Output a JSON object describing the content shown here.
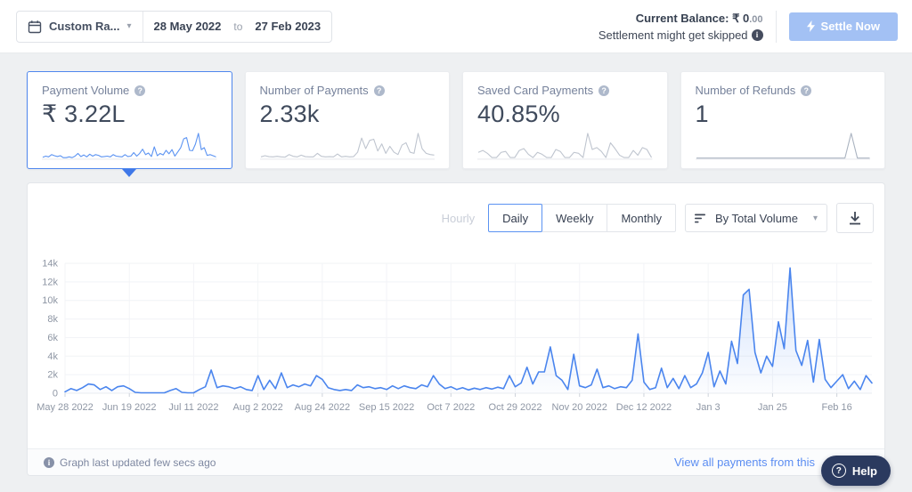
{
  "topbar": {
    "range_label": "Custom Ra...",
    "date_from": "28 May 2022",
    "to": "to",
    "date_to": "27 Feb 2023",
    "balance_label": "Current Balance:",
    "balance_currency": "₹",
    "balance_whole": "0",
    "balance_decimals": ".00",
    "settlement_note": "Settlement might get skipped",
    "settle_label": "Settle Now"
  },
  "cards": [
    {
      "label": "Payment Volume",
      "value": "₹ 3.22L",
      "selected": true
    },
    {
      "label": "Number of Payments",
      "value": "2.33k",
      "selected": false
    },
    {
      "label": "Saved Card Payments",
      "value": "40.85%",
      "selected": false
    },
    {
      "label": "Number of Refunds",
      "value": "1",
      "selected": false
    }
  ],
  "controls": {
    "tabs": [
      {
        "label": "Hourly",
        "state": "disabled"
      },
      {
        "label": "Daily",
        "state": "selected"
      },
      {
        "label": "Weekly",
        "state": "normal"
      },
      {
        "label": "Monthly",
        "state": "normal"
      }
    ],
    "sort_label": "By Total Volume"
  },
  "footer": {
    "updated": "Graph last updated few secs ago",
    "link": "View all payments from this"
  },
  "help": {
    "label": "Help"
  },
  "colors": {
    "accent_blue": "#4a85ee",
    "selected_card_border": "#4f87ee",
    "settle_button_bg": "#a3c1f4",
    "help_button_bg": "#2b3a5f",
    "spark_gray": "#bfc5cf",
    "axis_text": "#8e96a4",
    "grid_line": "#f1f3f6",
    "link_blue": "#5b8df2"
  },
  "icons": {
    "calendar-icon": "date range picker",
    "chevron-down-icon": "▾",
    "info-icon": "i in filled circle",
    "bolt-icon": "lightning flash on settle button",
    "question-icon": "? in circle",
    "sort-icon": "three descending bars",
    "download-icon": "arrow down to bar"
  },
  "chart_data": [
    {
      "type": "area",
      "title": "Daily Payment Volume",
      "granularity": "Daily",
      "xlabel": "",
      "ylabel": "",
      "ylim": [
        0,
        14000
      ],
      "grid": true,
      "legend": "none",
      "y_tick_labels": [
        "0",
        "2k",
        "4k",
        "6k",
        "8k",
        "10k",
        "12k",
        "14k"
      ],
      "x_tick_labels": [
        "May 28 2022",
        "Jun 19 2022",
        "Jul 11 2022",
        "Aug 2 2022",
        "Aug 24 2022",
        "Sep 15 2022",
        "Oct 7 2022",
        "Oct 29 2022",
        "Nov 20 2022",
        "Dec 12 2022",
        "Jan 3",
        "Jan 25",
        "Feb 16"
      ],
      "x_tick_indices": [
        0,
        11,
        22,
        33,
        44,
        55,
        66,
        77,
        88,
        99,
        110,
        121,
        132
      ],
      "values_unit": "thousands",
      "values_k": [
        0.15,
        0.5,
        0.3,
        0.6,
        1.0,
        0.9,
        0.4,
        0.7,
        0.3,
        0.7,
        0.8,
        0.5,
        0.1,
        0.05,
        0.05,
        0.05,
        0.05,
        0.05,
        0.3,
        0.5,
        0.1,
        0.05,
        0.05,
        0.4,
        0.7,
        2.5,
        0.6,
        0.8,
        0.7,
        0.5,
        0.7,
        0.4,
        0.3,
        1.9,
        0.4,
        1.4,
        0.5,
        2.2,
        0.6,
        0.9,
        0.7,
        1.0,
        0.8,
        1.9,
        1.5,
        0.6,
        0.4,
        0.3,
        0.4,
        0.3,
        0.9,
        0.6,
        0.7,
        0.5,
        0.6,
        0.4,
        0.8,
        0.5,
        0.8,
        0.6,
        0.5,
        0.9,
        0.7,
        1.9,
        1.0,
        0.5,
        0.7,
        0.4,
        0.6,
        0.35,
        0.55,
        0.4,
        0.6,
        0.45,
        0.65,
        0.5,
        1.9,
        0.7,
        1.1,
        2.8,
        1.0,
        2.3,
        2.3,
        5.0,
        1.9,
        1.4,
        0.4,
        4.2,
        0.8,
        0.6,
        0.9,
        2.6,
        0.6,
        0.8,
        0.5,
        0.7,
        0.6,
        1.4,
        6.4,
        1.2,
        0.4,
        0.6,
        2.7,
        0.6,
        1.6,
        0.5,
        1.9,
        0.6,
        1.0,
        2.2,
        4.4,
        0.7,
        2.4,
        1.0,
        5.6,
        3.2,
        10.6,
        11.2,
        4.4,
        2.2,
        4.0,
        2.9,
        7.7,
        4.8,
        13.5,
        4.6,
        3.0,
        5.7,
        1.2,
        5.8,
        1.5,
        0.6,
        1.3,
        2.0,
        0.5,
        1.3,
        0.4,
        1.9,
        1.1
      ],
      "line_color": "#4a85ee"
    },
    {
      "type": "sparkline",
      "metric": "Payment Volume",
      "color": "#5b93f2",
      "values_k": [
        0.2,
        0.5,
        0.3,
        0.9,
        0.6,
        0.4,
        0.6,
        0.1,
        0.1,
        0.3,
        0.1,
        0.5,
        1.2,
        0.4,
        0.8,
        0.3,
        1.0,
        0.5,
        0.9,
        0.7,
        0.3,
        0.4,
        0.5,
        0.3,
        0.9,
        0.5,
        0.4,
        0.3,
        0.9,
        0.4,
        0.5,
        1.4,
        0.5,
        1.2,
        2.3,
        0.9,
        1.3,
        0.4,
        2.9,
        0.6,
        1.2,
        0.8,
        2.0,
        1.1,
        2.2,
        0.5,
        1.6,
        2.7,
        5.0,
        5.3,
        2.0,
        1.9,
        3.6,
        6.4,
        2.2,
        2.7,
        0.7,
        0.9,
        0.6,
        0.3
      ]
    },
    {
      "type": "sparkline",
      "metric": "Number of Payments",
      "color": "#bfc5cf",
      "values_k": [
        0.1,
        0.2,
        0.12,
        0.1,
        0.15,
        0.1,
        0.08,
        0.3,
        0.15,
        0.1,
        0.25,
        0.12,
        0.1,
        0.1,
        0.4,
        0.15,
        0.1,
        0.12,
        0.1,
        0.35,
        0.1,
        0.15,
        0.1,
        0.12,
        0.5,
        1.7,
        0.8,
        1.5,
        1.6,
        0.6,
        1.2,
        0.4,
        1.0,
        0.5,
        0.3,
        1.1,
        1.3,
        0.5,
        0.4,
        2.1,
        0.8,
        0.4,
        0.3,
        0.25
      ]
    },
    {
      "type": "sparkline",
      "metric": "Saved Card Payments",
      "color": "#bfc5cf",
      "values_k": [
        0.6,
        0.8,
        0.5,
        0.05,
        0.05,
        0.6,
        0.7,
        0.05,
        0.05,
        0.8,
        1.0,
        0.4,
        0.05,
        0.6,
        0.4,
        0.05,
        0.05,
        0.9,
        0.7,
        0.05,
        0.05,
        0.6,
        0.5,
        0.05,
        2.6,
        0.9,
        1.1,
        0.7,
        0.05,
        1.6,
        1.0,
        0.3,
        0.05,
        0.05,
        0.8,
        0.3,
        1.1,
        0.9,
        0.05
      ]
    },
    {
      "type": "sparkline",
      "metric": "Number of Refunds",
      "color": "#aab3c0",
      "values_k": [
        0,
        0,
        0,
        0,
        0,
        0,
        0,
        0,
        0,
        0,
        0,
        0,
        0,
        0,
        0,
        0,
        0,
        0,
        0,
        0,
        0,
        0,
        0,
        0,
        0,
        1,
        0,
        0,
        0
      ]
    }
  ]
}
